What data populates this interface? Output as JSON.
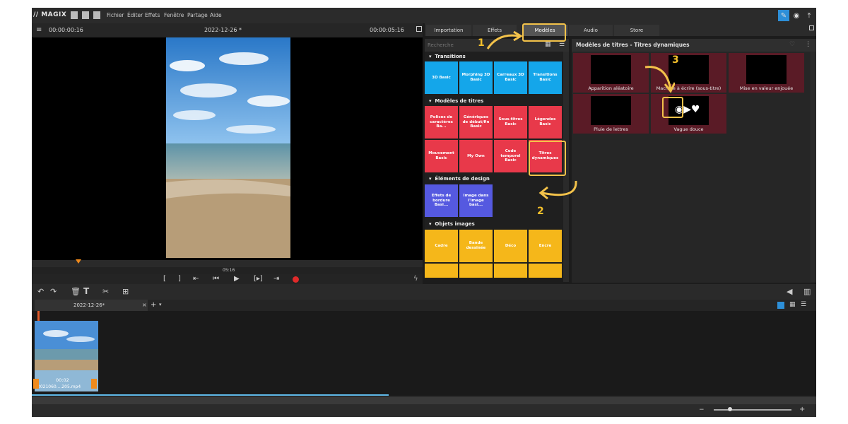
{
  "app": {
    "logo": "// MAGIX"
  },
  "menu": [
    "Fichier",
    "Éditer",
    "Effets",
    "Fenêtre",
    "Partage",
    "Aide"
  ],
  "player": {
    "timecode_start": "00:00:00:16",
    "project_title": "2022-12-26 *",
    "timecode_end": "00:00:05:16",
    "scrub_time": "05:16"
  },
  "tabs": [
    "Importation",
    "Effets",
    "Modèles",
    "Audio",
    "Store"
  ],
  "search": {
    "placeholder": "Recherche"
  },
  "categories": {
    "transitions": {
      "title": "Transitions",
      "tiles": [
        "3D Basic",
        "Morphing 3D Basic",
        "Carreaux 3D Basic",
        "Transitions Basic"
      ]
    },
    "titles": {
      "title": "Modèles de titres",
      "tiles": [
        "Polices de caractères Ba...",
        "Génériques de début/fin Basic",
        "Sous-titres Basic",
        "Légendes Basic",
        "Mouvement Basic",
        "My Own",
        "Code temporel Basic",
        "Titres dynamiques"
      ]
    },
    "design": {
      "title": "Éléments de design",
      "tiles": [
        "Effets de bordure Basi...",
        "Image dans l'image basi..."
      ]
    },
    "images": {
      "title": "Objets images",
      "tiles": [
        "Cadre",
        "Bande dessinée",
        "Déco",
        "Encre"
      ]
    }
  },
  "templates_panel": {
    "header": "Modèles de titres - Titres dynamiques",
    "items": [
      "Apparition aléatoire",
      "Machine à écrire (sous-titre)",
      "Mise en valeur enjouée",
      "Pluie de lettres",
      "Vague douce"
    ]
  },
  "timeline": {
    "tab_label": "2022-12-26*",
    "clip_duration": "00:02",
    "clip_name": "2021060....205.mp4"
  },
  "annotations": [
    "1",
    "2",
    "3"
  ],
  "colors": {
    "accent_yellow": "#f3c24a",
    "tile_blue": "#14a6ea",
    "tile_red": "#e8394a",
    "tile_yellow": "#f5b71a",
    "template_bg": "#5a1b26"
  }
}
